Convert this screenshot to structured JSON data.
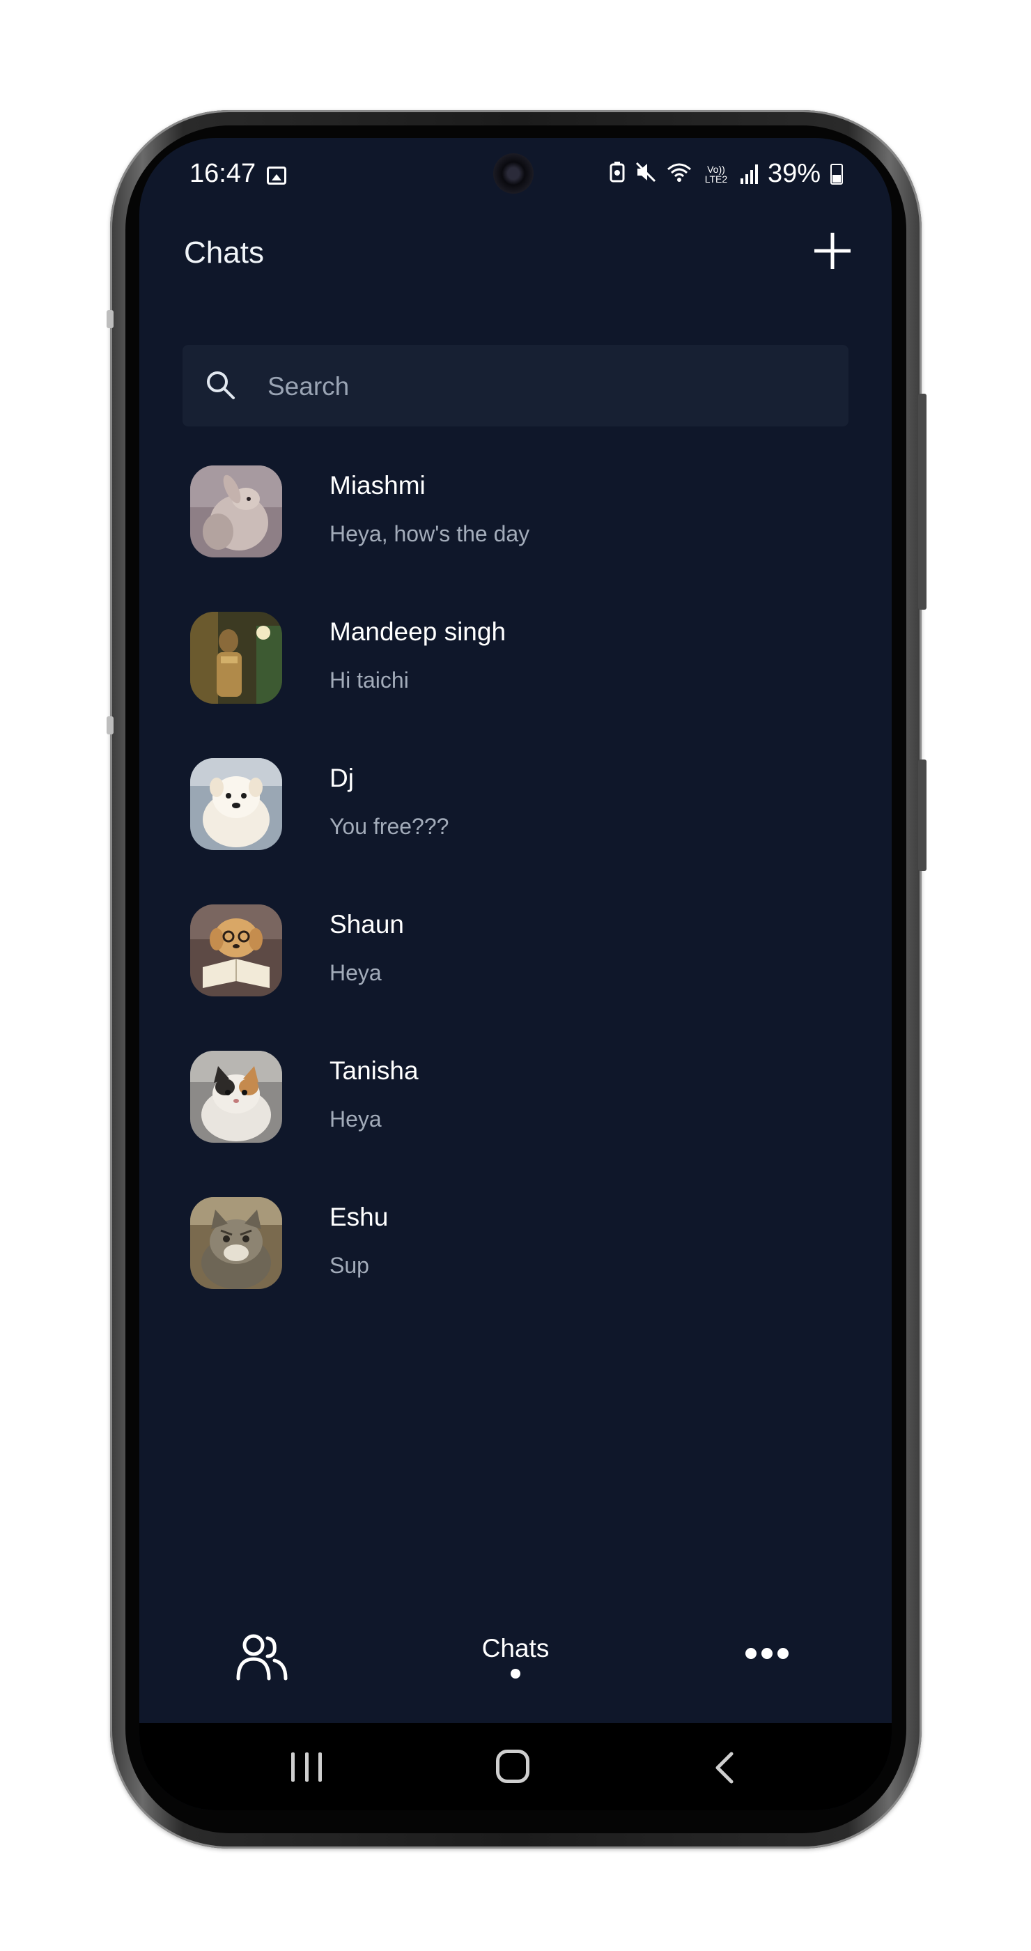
{
  "status_bar": {
    "time": "16:47",
    "battery_percent": "39%",
    "icons": [
      "gallery-icon",
      "battery-saver-icon",
      "mute-icon",
      "wifi-icon",
      "volte-icon",
      "signal-icon",
      "battery-icon"
    ],
    "volte_label": "Vo)) LTE2"
  },
  "header": {
    "title": "Chats",
    "add_icon": "plus-icon"
  },
  "search": {
    "placeholder": "Search",
    "value": ""
  },
  "chats": [
    {
      "name": "Miashmi",
      "preview": "Heya, how's the day",
      "avatar": "bunny-photo"
    },
    {
      "name": "Mandeep singh",
      "preview": "Hi taichi",
      "avatar": "person-photo"
    },
    {
      "name": "Dj",
      "preview": "You free???",
      "avatar": "puppy-photo"
    },
    {
      "name": "Shaun",
      "preview": "Heya",
      "avatar": "dog-with-book-photo"
    },
    {
      "name": "Tanisha",
      "preview": "Heya",
      "avatar": "kitten-photo"
    },
    {
      "name": "Eshu",
      "preview": "Sup",
      "avatar": "cat-photo"
    }
  ],
  "bottom_nav": {
    "contacts_icon": "users-icon",
    "chats_label": "Chats",
    "more_icon": "more-dots-icon"
  },
  "colors": {
    "background": "#0f172a",
    "search_background": "#172033",
    "text_primary": "#ffffff",
    "text_secondary": "#a3acba"
  }
}
